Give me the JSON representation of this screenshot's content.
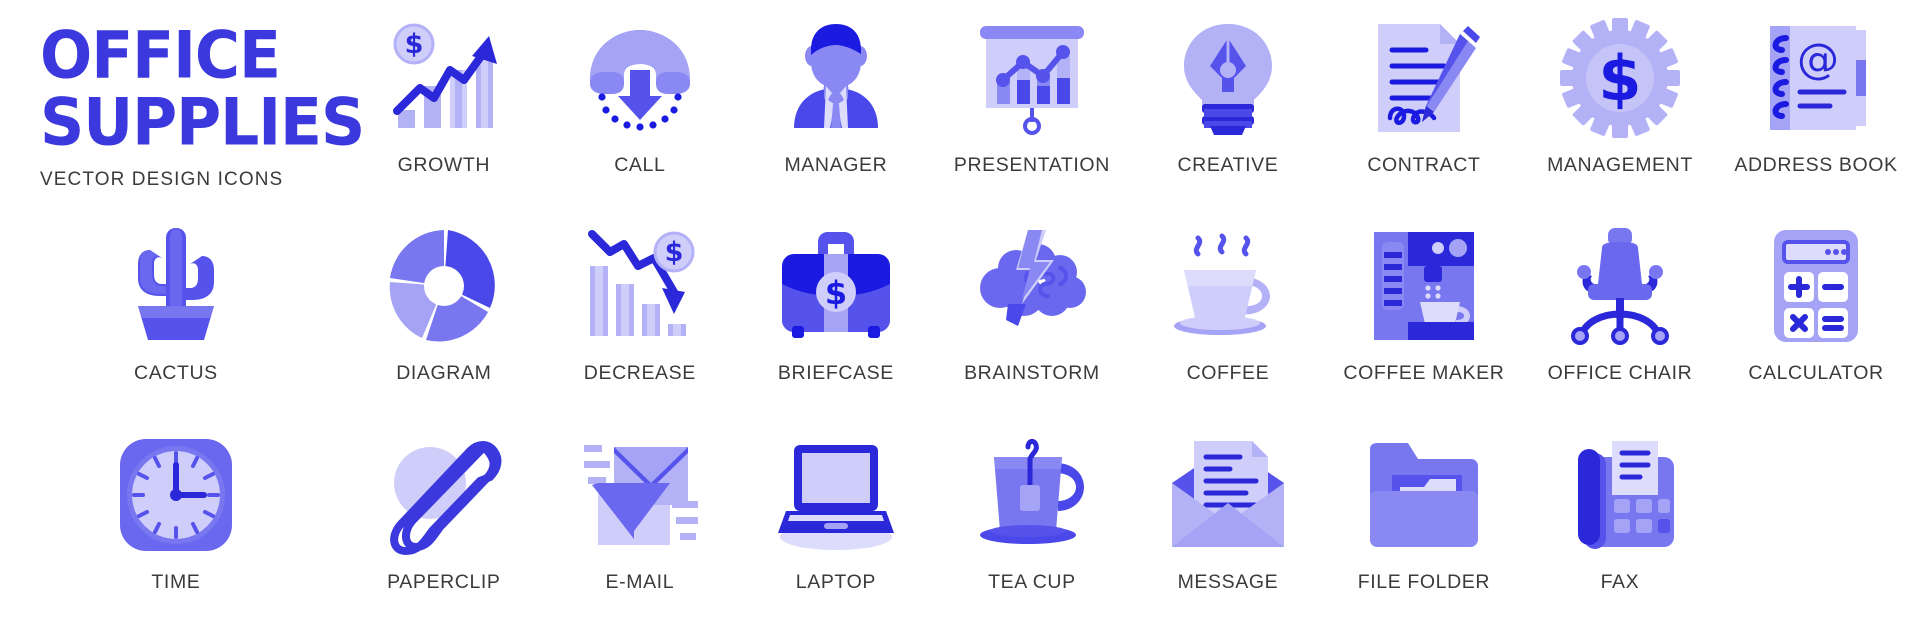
{
  "brand": {
    "title_line1": "OFFICE",
    "title_line2": "SUPPLIES",
    "subtitle": "VECTOR DESIGN ICONS"
  },
  "palette": {
    "brand_blue": "#3b39dd",
    "deep_blue": "#1a1ae0",
    "mid_blue": "#4a4ae8",
    "periwinkle": "#7b79f0",
    "light_lavender": "#b3b2f7",
    "pale_lavender": "#cfcefa",
    "paler_lavender": "#dedcfd",
    "caption_gray": "#3b3b3b",
    "background": "#ffffff"
  },
  "grid": {
    "columns": 9,
    "rows": 3,
    "total_icons": 26
  },
  "icons": [
    {
      "id": "title-block",
      "label": "",
      "icon": "office-supplies-title"
    },
    {
      "id": "growth",
      "label": "GROWTH",
      "icon": "growth-icon"
    },
    {
      "id": "call",
      "label": "CALL",
      "icon": "call-icon"
    },
    {
      "id": "manager",
      "label": "MANAGER",
      "icon": "manager-icon"
    },
    {
      "id": "presentation",
      "label": "PRESENTATION",
      "icon": "presentation-icon"
    },
    {
      "id": "creative",
      "label": "CREATIVE",
      "icon": "creative-icon"
    },
    {
      "id": "contract",
      "label": "CONTRACT",
      "icon": "contract-icon"
    },
    {
      "id": "management",
      "label": "MANAGEMENT",
      "icon": "management-icon"
    },
    {
      "id": "address-book",
      "label": "ADDRESS BOOK",
      "icon": "address-book-icon"
    },
    {
      "id": "cactus",
      "label": "CACTUS",
      "icon": "cactus-icon"
    },
    {
      "id": "diagram",
      "label": "DIAGRAM",
      "icon": "diagram-icon"
    },
    {
      "id": "decrease",
      "label": "DECREASE",
      "icon": "decrease-icon"
    },
    {
      "id": "briefcase",
      "label": "BRIEFCASE",
      "icon": "briefcase-icon"
    },
    {
      "id": "brainstorm",
      "label": "BRAINSTORM",
      "icon": "brainstorm-icon"
    },
    {
      "id": "coffee",
      "label": "COFFEE",
      "icon": "coffee-icon"
    },
    {
      "id": "coffee-maker",
      "label": "COFFEE MAKER",
      "icon": "coffee-maker-icon"
    },
    {
      "id": "office-chair",
      "label": "OFFICE CHAIR",
      "icon": "office-chair-icon"
    },
    {
      "id": "calculator",
      "label": "CALCULATOR",
      "icon": "calculator-icon"
    },
    {
      "id": "time",
      "label": "TIME",
      "icon": "clock-icon"
    },
    {
      "id": "paperclip",
      "label": "PAPERCLIP",
      "icon": "paperclip-icon"
    },
    {
      "id": "email",
      "label": "E-MAIL",
      "icon": "email-icon"
    },
    {
      "id": "laptop",
      "label": "LAPTOP",
      "icon": "laptop-icon"
    },
    {
      "id": "tea-cup",
      "label": "TEA CUP",
      "icon": "tea-cup-icon"
    },
    {
      "id": "message",
      "label": "MESSAGE",
      "icon": "message-icon"
    },
    {
      "id": "file-folder",
      "label": "FILE FOLDER",
      "icon": "file-folder-icon"
    },
    {
      "id": "fax",
      "label": "FAX",
      "icon": "fax-icon"
    }
  ],
  "captions": {
    "growth": "GROWTH",
    "call": "CALL",
    "manager": "MANAGER",
    "presentation": "PRESENTATION",
    "creative": "CREATIVE",
    "contract": "CONTRACT",
    "management": "MANAGEMENT",
    "address_book": "ADDRESS BOOK",
    "cactus": "CACTUS",
    "diagram": "DIAGRAM",
    "decrease": "DECREASE",
    "briefcase": "BRIEFCASE",
    "brainstorm": "BRAINSTORM",
    "coffee": "COFFEE",
    "coffee_maker": "COFFEE MAKER",
    "office_chair": "OFFICE CHAIR",
    "calculator": "CALCULATOR",
    "time": "TIME",
    "paperclip": "PAPERCLIP",
    "email": "E-MAIL",
    "laptop": "LAPTOP",
    "tea_cup": "TEA CUP",
    "message": "MESSAGE",
    "file_folder": "FILE FOLDER",
    "fax": "FAX"
  },
  "symbols": {
    "currency": "$",
    "at_sign": "@",
    "calculator_keys": [
      "+",
      "−",
      "×",
      "="
    ],
    "clock_time": "3:00"
  }
}
